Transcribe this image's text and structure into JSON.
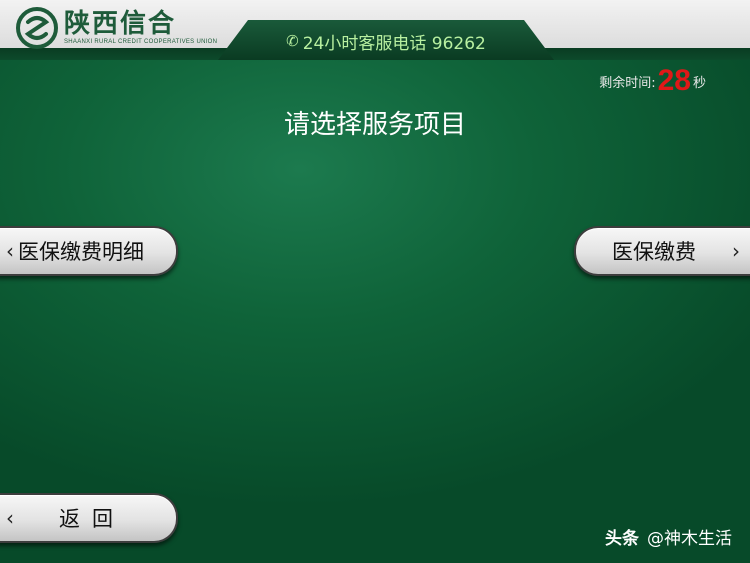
{
  "header": {
    "logo_name": "陕西信合",
    "logo_subtitle": "SHAANXI RURAL CREDIT COOPERATIVES UNION",
    "phone_label": "24小时客服电话 96262",
    "phone_icon": "phone-icon"
  },
  "timer": {
    "label": "剩余时间:",
    "seconds": "28",
    "unit": "秒"
  },
  "prompt": "请选择服务项目",
  "buttons": {
    "left_top": {
      "label": "医保缴费明细",
      "chevron": "‹"
    },
    "right_top": {
      "label": "医保缴费",
      "chevron": "›"
    },
    "back": {
      "label": "返回",
      "chevron": "‹"
    }
  },
  "watermark": {
    "brand": "头条",
    "handle": "@神木生活"
  },
  "colors": {
    "background": "#0f6339",
    "timer_number": "#e01818",
    "phone_text": "#b8f0a0",
    "logo": "#1e5b3a"
  }
}
